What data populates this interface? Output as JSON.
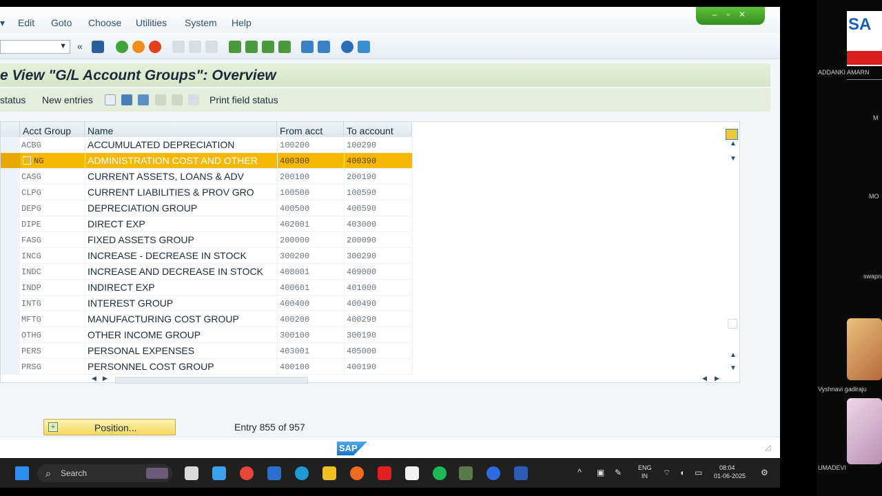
{
  "menu": [
    "Edit",
    "Goto",
    "Choose",
    "Utilities",
    "System",
    "Help"
  ],
  "title": "e View \"G/L Account Groups\": Overview",
  "app_toolbar": {
    "field_status": "status",
    "new_entries": "New entries",
    "print_field_status": "Print field status"
  },
  "table": {
    "headers": [
      "Acct Group",
      "Name",
      "From acct",
      "To account"
    ],
    "rows": [
      {
        "group": "ACBG",
        "name": "ACCUMULATED DEPRECIATION",
        "from": "100200",
        "to": "100290"
      },
      {
        "group": "NG",
        "name": "ADMINISTRATION COST AND  OTHER",
        "from": "400300",
        "to": "400390"
      },
      {
        "group": "CASG",
        "name": "CURRENT ASSETS, LOANS & ADV",
        "from": "200100",
        "to": "200190"
      },
      {
        "group": "CLPG",
        "name": "CURRENT LIABILITIES & PROV GRO",
        "from": "100500",
        "to": "100590"
      },
      {
        "group": "DEPG",
        "name": "DEPRECIATION GROUP",
        "from": "400500",
        "to": "400590"
      },
      {
        "group": "DIPE",
        "name": "DIRECT EXP",
        "from": "402001",
        "to": "403000"
      },
      {
        "group": "FASG",
        "name": "FIXED ASSETS GROUP",
        "from": "200000",
        "to": "200090"
      },
      {
        "group": "INCG",
        "name": "INCREASE - DECREASE IN STOCK",
        "from": "300200",
        "to": "300290"
      },
      {
        "group": "INDC",
        "name": "INCREASE AND DECREASE IN STOCK",
        "from": "408001",
        "to": "409000"
      },
      {
        "group": "INDP",
        "name": "INDIRECT EXP",
        "from": "400601",
        "to": "401000"
      },
      {
        "group": "INTG",
        "name": "INTEREST GROUP",
        "from": "400400",
        "to": "400490"
      },
      {
        "group": "MFTG",
        "name": "MANUFACTURING COST  GROUP",
        "from": "400200",
        "to": "400290"
      },
      {
        "group": "OTHG",
        "name": "OTHER INCOME GROUP",
        "from": "300100",
        "to": "300190"
      },
      {
        "group": "PERS",
        "name": "PERSONAL EXPENSES",
        "from": "403001",
        "to": "405000"
      },
      {
        "group": "PRSG",
        "name": "PERSONNEL COST GROUP",
        "from": "400100",
        "to": "400190"
      }
    ]
  },
  "position_button": "Position...",
  "entry_status": "Entry 855 of 957",
  "sap_logo_text": "SAP",
  "taskbar": {
    "search": "Search",
    "lang_top": "ENG",
    "lang_bottom": "IN",
    "time": "08:04",
    "date": "01-06-2025"
  },
  "participants": [
    {
      "name": "ADDANKI AMARN"
    },
    {
      "name": "M"
    },
    {
      "name": "MO"
    },
    {
      "name": "swapna"
    },
    {
      "name": "Vyshnavi gadiraju"
    },
    {
      "name": "UMADEVI"
    }
  ],
  "colors": {
    "selected_row": "#f5b800",
    "title_band": "#d5e5c5",
    "window_ctrl": "#2f8f1c",
    "sap_blue": "#1a73c8"
  }
}
